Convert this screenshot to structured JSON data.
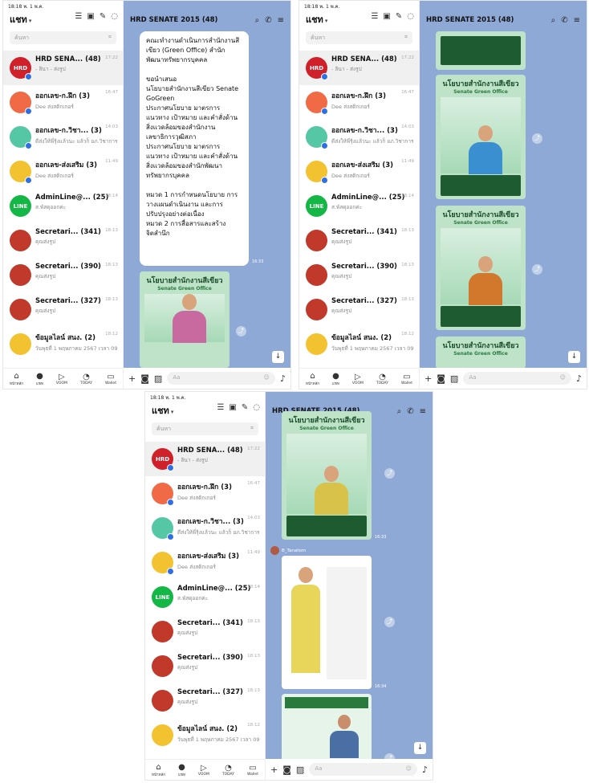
{
  "status": {
    "time": "18:18  พ. 1 พ.ค.",
    "battery": "82%"
  },
  "left": {
    "title": "แชท",
    "search_placeholder": "ค้นหา",
    "items": [
      {
        "name": "HRD SENA... (48)",
        "sub": "- ลินา - ส่งรูป",
        "time": "17:22",
        "avatar_text": "HRD",
        "color": "#d0202a"
      },
      {
        "name": "ออกเลข-ก.ฝึก (3)",
        "sub": "Dee ส่งสติกเกอร์",
        "time": "16:47",
        "avatar_text": "",
        "color": "#ef6a45"
      },
      {
        "name": "ออกเลข-ก.วิชา... (3)",
        "sub": "ดีส่งให้พี่รุ้งแล้วนะ แล้วก็ อภ.วิชาการ",
        "time": "14:03",
        "avatar_text": "",
        "color": "#55c7a5"
      },
      {
        "name": "ออกเลข-ส่งเสริม (3)",
        "sub": "Dee ส่งสติกเกอร์",
        "time": "11:49",
        "avatar_text": "",
        "color": "#f2c230"
      },
      {
        "name": "AdminLine@... (25)",
        "sub": "ส.พัสดุออกค่ะ",
        "time": "18:14",
        "avatar_text": "LINE",
        "color": "#14b746"
      },
      {
        "name": "Secretari... (341)",
        "sub": "คุณส่งรูป",
        "time": "18:13",
        "avatar_text": "",
        "color": "#c0392b"
      },
      {
        "name": "Secretari... (390)",
        "sub": "คุณส่งรูป",
        "time": "18:13",
        "avatar_text": "",
        "color": "#c0392b"
      },
      {
        "name": "Secretari... (327)",
        "sub": "คุณส่งรูป",
        "time": "18:13",
        "avatar_text": "",
        "color": "#c0392b"
      },
      {
        "name": "ข้อมูลไลน์ สนง. (2)",
        "sub": "วันพุธที่ 1 พฤษภาคม 2567 เวลา 09.00 - 1...",
        "time": "18:12",
        "avatar_text": "",
        "color": "#f2c230"
      }
    ],
    "tabs": [
      "หน้าหลัก",
      "แชท",
      "VOOM",
      "TODAY",
      "Wallet"
    ]
  },
  "right": {
    "title": "HRD SENATE 2015 (48)",
    "message_text": "คณะทำงานดำเนินการสำนักงานสีเขียว (Green Office) สำนักพัฒนาทรัพยากรบุคคล\n\nขอนำเสนอ\nนโยบายสำนักงานสีเขียว Senate GoGreen\nประกาศนโยบาย มาตรการ แนวทาง เป้าหมาย และคำสั่งด้านสิ่งแวดล้อมของสำนักงานเลขาธิการวุฒิสภา\nประกาศนโยบาย มาตรการ แนวทาง เป้าหมาย และคำสั่งด้านสิ่งแวดล้อมของสำนักพัฒนาทรัพยากรบุคคล\n\nหมวด 1 การกำหนดนโยบาย การวางแผนดำเนินงาน และการปรับปรุงอย่างต่อเนื่อง\nหมวด 2 การสื่อสารและสร้างจิตสำนึก",
    "msg_time": "16:33",
    "poster_title": "นโยบายสำนักงานสีเขียว",
    "poster_sub": "Senate Green Office",
    "sender": "B_Tanatorn",
    "msg_time2": "16:34",
    "input_placeholder": "Aa"
  }
}
